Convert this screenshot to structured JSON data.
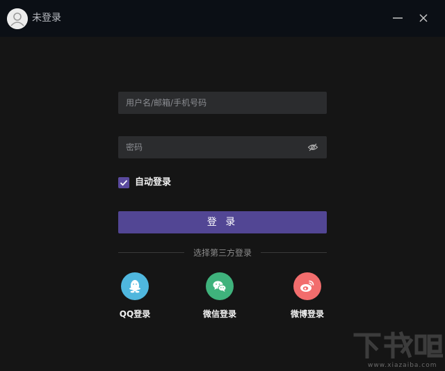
{
  "titlebar": {
    "status_text": "未登录",
    "avatar_icon": "user-avatar-icon",
    "minimize_icon": "minimize-icon",
    "close_icon": "close-icon"
  },
  "form": {
    "username_placeholder": "用户名/邮箱/手机号码",
    "username_value": "",
    "password_placeholder": "密码",
    "password_value": "",
    "password_toggle_icon": "eye-off-icon",
    "auto_login_label": "自动登录",
    "auto_login_checked": true,
    "login_button_label": "登 录"
  },
  "third_party": {
    "divider_text": "选择第三方登录",
    "options": [
      {
        "label": "QQ登录",
        "icon": "qq-icon",
        "color": "#4fb7de"
      },
      {
        "label": "微信登录",
        "icon": "wechat-icon",
        "color": "#3fb27c"
      },
      {
        "label": "微博登录",
        "icon": "weibo-icon",
        "color": "#f26d6d"
      }
    ]
  },
  "colors": {
    "background": "#151515",
    "titlebar": "#0b0f15",
    "field": "#2b2c2e",
    "accent": "#524694"
  },
  "watermark": {
    "logo_text": "下载吧",
    "url": "www.xiazaiba.com"
  }
}
